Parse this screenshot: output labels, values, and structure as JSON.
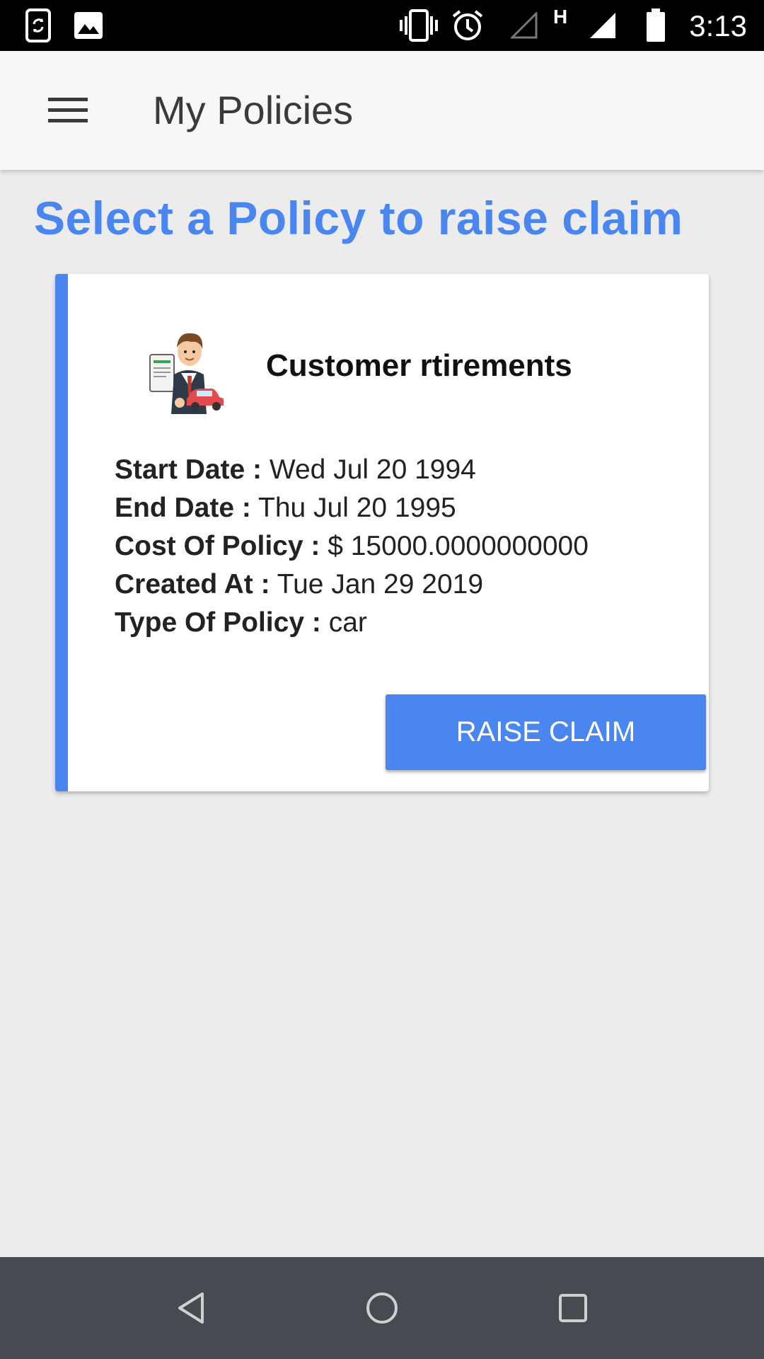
{
  "status_bar": {
    "time": "3:13",
    "network_label": "H",
    "icons": [
      "sync-phone-icon",
      "image-icon",
      "vibrate-icon",
      "alarm-icon",
      "signal-empty-icon",
      "signal-full-icon",
      "battery-icon"
    ]
  },
  "app_bar": {
    "title": "My Policies",
    "menu_icon": "hamburger-menu-icon"
  },
  "page": {
    "heading": "Select a Policy to raise claim"
  },
  "policies": [
    {
      "name": "Customer rtirements",
      "icon": "agent-with-car-illustration",
      "details": [
        {
          "label": "Start Date :",
          "value": "Wed Jul 20 1994"
        },
        {
          "label": "End Date :",
          "value": "Thu Jul 20 1995"
        },
        {
          "label": "Cost Of Policy :",
          "value": "$ 15000.0000000000"
        },
        {
          "label": "Created At :",
          "value": "Tue Jan 29 2019"
        },
        {
          "label": "Type Of Policy :",
          "value": "car"
        }
      ],
      "action_label": "RAISE CLAIM"
    }
  ],
  "colors": {
    "accent": "#4a86f0",
    "background": "#ececec",
    "nav_bar": "#454b50"
  },
  "nav_bar": {
    "icons": [
      "back-icon",
      "home-icon",
      "recents-icon"
    ]
  }
}
